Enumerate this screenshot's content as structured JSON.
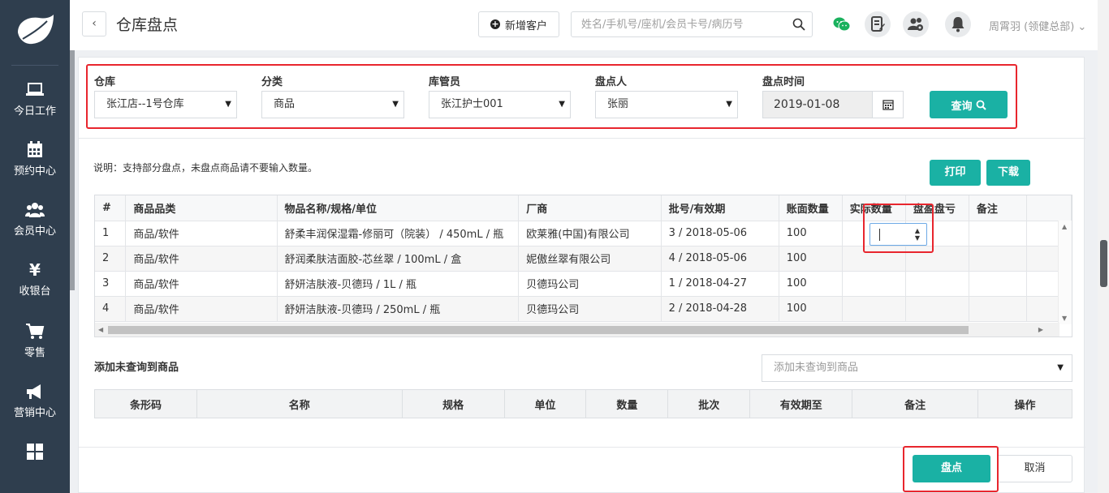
{
  "sidebar": {
    "items": [
      {
        "label": "今日工作",
        "icon": "laptop-icon"
      },
      {
        "label": "预约中心",
        "icon": "calendar-icon"
      },
      {
        "label": "会员中心",
        "icon": "users-icon"
      },
      {
        "label": "收银台",
        "icon": "yen-icon"
      },
      {
        "label": "零售",
        "icon": "cart-icon"
      },
      {
        "label": "营销中心",
        "icon": "megaphone-icon"
      },
      {
        "label": "",
        "icon": "grid-icon"
      }
    ]
  },
  "header": {
    "back": "‹",
    "title": "仓库盘点",
    "add_customer": "新增客户",
    "search_placeholder": "姓名/手机号/座机/会员卡号/病历号",
    "user": "周霄羽 (领健总部)",
    "user_caret": "⌄"
  },
  "filters": {
    "warehouse_label": "仓库",
    "warehouse_value": "张江店--1号仓库",
    "category_label": "分类",
    "category_value": "商品",
    "keeper_label": "库管员",
    "keeper_value": "张江护士001",
    "counter_label": "盘点人",
    "counter_value": "张丽",
    "time_label": "盘点时间",
    "time_value": "2019-01-08",
    "query_label": "查询"
  },
  "note": "说明：支持部分盘点，未盘点商品请不要输入数量。",
  "actions": {
    "print": "打印",
    "download": "下载"
  },
  "grid": {
    "headers": [
      "#",
      "商品品类",
      "物品名称/规格/单位",
      "厂商",
      "批号/有效期",
      "账面数量",
      "实际数量",
      "盘盈盘亏",
      "备注"
    ],
    "rows": [
      [
        "1",
        "商品/软件",
        "舒柔丰润保湿霜-修丽可（院装） / 450mL / 瓶",
        "欧莱雅(中国)有限公司",
        "3 / 2018-05-06",
        "100",
        "",
        "",
        ""
      ],
      [
        "2",
        "商品/软件",
        "舒润柔肤洁面胶-芯丝翠 / 100mL / 盒",
        "妮傲丝翠有限公司",
        "4 / 2018-05-06",
        "100",
        "",
        "",
        ""
      ],
      [
        "3",
        "商品/软件",
        "舒妍洁肤液-贝德玛 / 1L / 瓶",
        "贝德玛公司",
        "1 / 2018-04-27",
        "100",
        "",
        "",
        ""
      ],
      [
        "4",
        "商品/软件",
        "舒妍洁肤液-贝德玛 / 250mL / 瓶",
        "贝德玛公司",
        "2 / 2018-04-28",
        "100",
        "",
        "",
        ""
      ]
    ]
  },
  "add_section": {
    "label": "添加未查询到商品",
    "placeholder": "添加未查询到商品",
    "headers": [
      "条形码",
      "名称",
      "规格",
      "单位",
      "数量",
      "批次",
      "有效期至",
      "备注",
      "操作"
    ]
  },
  "footer": {
    "submit": "盘点",
    "cancel": "取消"
  },
  "colors": {
    "accent": "#1ab1a4",
    "sidebar": "#2f3e4e",
    "highlight": "#e8262e"
  }
}
